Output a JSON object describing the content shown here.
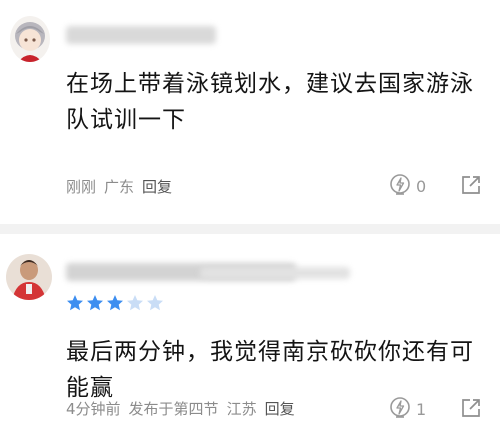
{
  "comments": [
    {
      "user_avatar": "anime-avatar-gray-hair",
      "text": "在场上带着泳镜划水，建议去国家游泳队试训一下",
      "time": "刚刚",
      "location": "广东",
      "reply_label": "回复",
      "like_count": "0"
    },
    {
      "user_avatar": "photo-avatar-basketball-player",
      "rating": 3,
      "rating_max": 5,
      "text": "最后两分钟，我觉得南京砍砍你还有可能赢",
      "time": "4分钟前",
      "posted_in": "发布于第四节",
      "location": "江苏",
      "reply_label": "回复",
      "like_count": "1"
    }
  ],
  "colors": {
    "star_filled": "#3d8ef0",
    "star_empty": "#c9ddf6",
    "meta_text": "#8c8c8c",
    "divider": "#f2f2f2"
  }
}
